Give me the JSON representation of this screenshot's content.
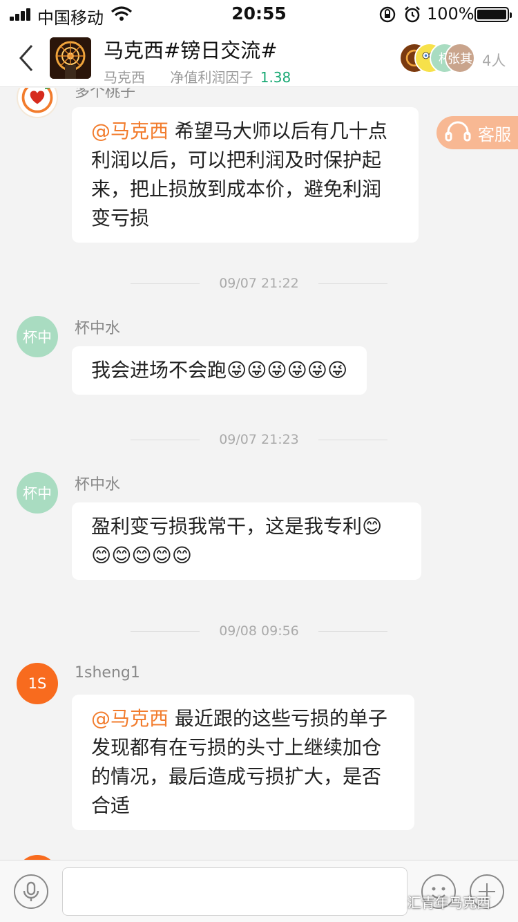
{
  "status_bar": {
    "carrier": "中国移动",
    "time": "20:55",
    "battery": "100%"
  },
  "header": {
    "title": "马克西#镑日交流#",
    "owner": "马克西",
    "factor_label": "净值利润因子",
    "factor_value": "1.38",
    "member_avatars": [
      "杯",
      "张其"
    ],
    "member_count": "4人"
  },
  "customer_service": {
    "label": "客服"
  },
  "messages": [
    {
      "sender": "多个桃子",
      "mention": "@马克西",
      "text": " 希望马大师以后有几十点利润以后，可以把利润及时保护起来，把止损放到成本价，避免利润变亏损"
    },
    {
      "timestamp": "09/07 21:22"
    },
    {
      "sender": "杯中水",
      "avatar_text": "杯中",
      "text": "我会进场不会跑😜😜😜😜😜😜"
    },
    {
      "timestamp": "09/07 21:23"
    },
    {
      "sender": "杯中水",
      "avatar_text": "杯中",
      "text": "盈利变亏损我常干，这是我专利😊😊😊😊😊😊"
    },
    {
      "timestamp": "09/08 09:56"
    },
    {
      "sender": "1sheng1",
      "avatar_text": "1S",
      "mention": "@马克西",
      "text": "  最近跟的这些亏损的单子发现都有在亏损的头寸上继续加仓的情况，最后造成亏损扩大，是否合适"
    }
  ],
  "input": {
    "placeholder": ""
  },
  "watermark": "汇青年马克西",
  "colors": {
    "accent_orange": "#f27c2d",
    "factor_green": "#19a974",
    "avatar_green": "#a9dcc1",
    "avatar_orange": "#f86b1e"
  }
}
